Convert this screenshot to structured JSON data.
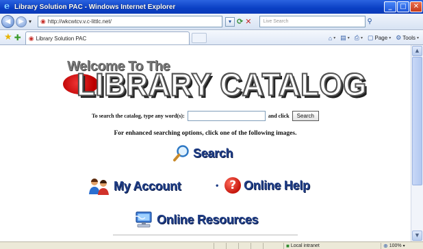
{
  "window": {
    "title": "Library Solution PAC - Windows Internet Explorer",
    "controls": {
      "minimize": "_",
      "maximize": "□",
      "close": "✕"
    }
  },
  "address_bar": {
    "url": "http://wkcwtcv.v.c-littlc.net/",
    "live_search_placeholder": "Live Search"
  },
  "tabs": [
    {
      "label": "Library Solution PAC"
    }
  ],
  "command_bar": {
    "page_label": "Page",
    "tools_label": "Tools"
  },
  "page": {
    "logo_welcome": "Welcome To The",
    "logo_catalog": "LIBRARY CATALOG",
    "search_prompt": "To search the catalog, type any word(s):",
    "search_value": "",
    "and_click": "and click",
    "search_button_label": "Search",
    "enhanced_text": "For enhanced searching options, click one of the following images.",
    "nav": {
      "search": "Search",
      "my_account": "My Account",
      "bullet": "•",
      "online_help": "Online Help",
      "online_resources": "Online Resources"
    }
  },
  "status_bar": {
    "zone": "Local intranet",
    "zoom": "100%"
  }
}
